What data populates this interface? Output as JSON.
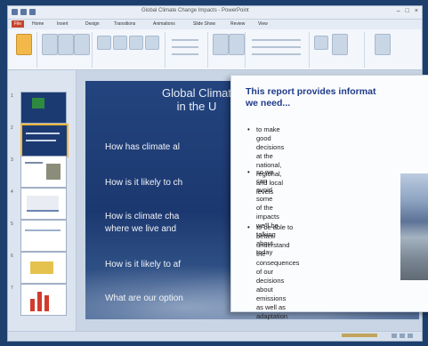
{
  "window": {
    "title": "Global Climate Change Impacts - PowerPoint"
  },
  "ribbon_tabs": [
    {
      "label": "File"
    },
    {
      "label": "Home"
    },
    {
      "label": "Insert"
    },
    {
      "label": "Design"
    },
    {
      "label": "Transitions"
    },
    {
      "label": "Animations"
    },
    {
      "label": "Slide Show"
    },
    {
      "label": "Review"
    },
    {
      "label": "View"
    }
  ],
  "thumbnails": [
    "1",
    "2",
    "3",
    "4",
    "5",
    "6",
    "7"
  ],
  "slide": {
    "title_line1": "Global Climat",
    "title_line2": "in the U",
    "bullets": [
      "How has climate al",
      "How is it likely to ch",
      "How is climate cha",
      "where we live and",
      "How is it likely to af",
      "What are our option"
    ]
  },
  "popup": {
    "title_line1": "This report provides informat",
    "title_line2": "we need...",
    "items": [
      {
        "lines": [
          "to make good decisions at the",
          "national, regional, and local levels"
        ]
      },
      {
        "lines": [
          "so we can avoid some of the",
          "impacts we'll be talking",
          "about today"
        ]
      },
      {
        "lines": [
          "to be able to better",
          "understand the",
          "consequences of our",
          "decisions about emissions",
          "as well as adaptation"
        ]
      }
    ]
  },
  "colors": {
    "accent": "#c6452c",
    "slide_bg": "#1c3870",
    "popup_title": "#1f3b8a"
  }
}
